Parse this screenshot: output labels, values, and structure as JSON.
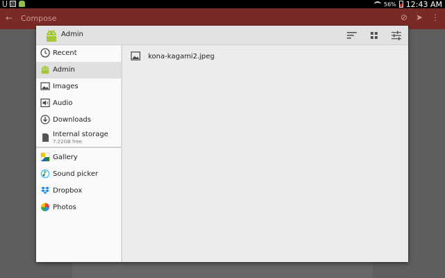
{
  "status_bar": {
    "battery": "56%",
    "time": "12:43 AM"
  },
  "background_app": {
    "title": "Compose"
  },
  "dialog": {
    "title": "Admin",
    "drawer": {
      "roots": [
        {
          "label": "Recent",
          "icon": "clock-icon",
          "selected": false
        },
        {
          "label": "Admin",
          "icon": "android-icon",
          "selected": true
        },
        {
          "label": "Images",
          "icon": "image-icon",
          "selected": false
        },
        {
          "label": "Audio",
          "icon": "audio-icon",
          "selected": false
        },
        {
          "label": "Downloads",
          "icon": "download-icon",
          "selected": false
        },
        {
          "label": "Internal storage",
          "sublabel": "7.22GB free",
          "icon": "sd-card-icon",
          "selected": false
        }
      ],
      "apps": [
        {
          "label": "Gallery",
          "icon": "gallery-icon"
        },
        {
          "label": "Sound picker",
          "icon": "sound-picker-icon"
        },
        {
          "label": "Dropbox",
          "icon": "dropbox-icon"
        },
        {
          "label": "Photos",
          "icon": "photos-icon"
        }
      ]
    },
    "files": [
      {
        "name": "kona-kagami2.jpeg",
        "icon": "image-file-icon"
      }
    ]
  },
  "colors": {
    "accent": "#c62828",
    "selected_row": "#e0e0e0",
    "android_green": "#a4c639"
  }
}
